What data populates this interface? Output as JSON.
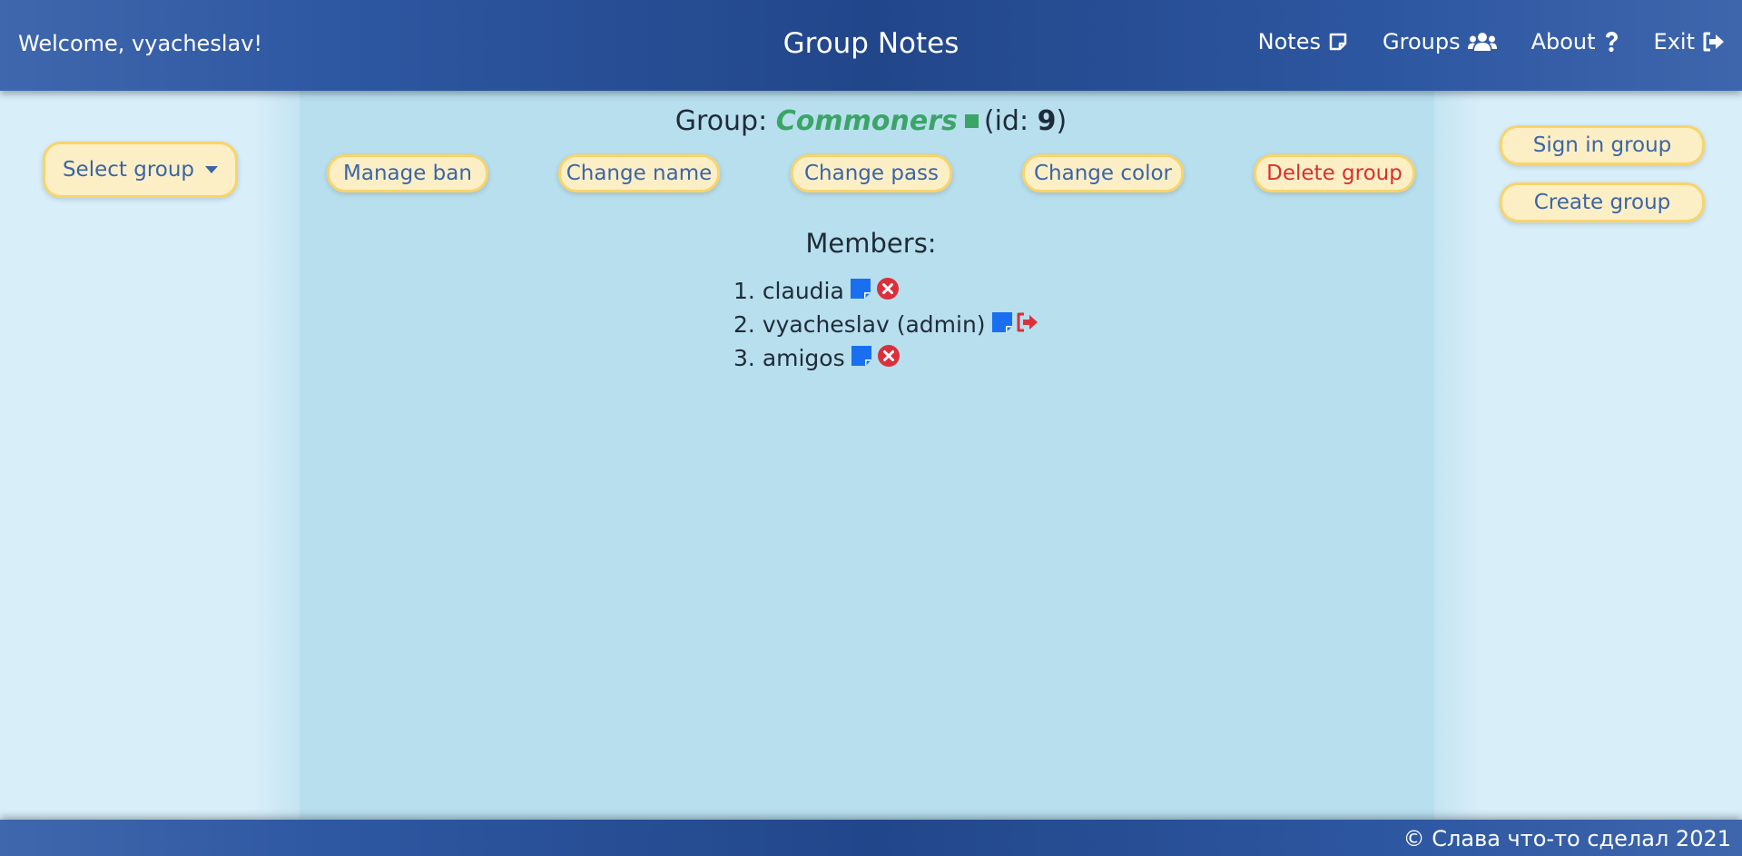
{
  "header": {
    "welcome": "Welcome, vyacheslav!",
    "title": "Group Notes",
    "nav": [
      {
        "label": "Notes",
        "icon": "note-icon"
      },
      {
        "label": "Groups",
        "icon": "users-icon"
      },
      {
        "label": "About",
        "icon": "question-icon"
      },
      {
        "label": "Exit",
        "icon": "sign-out-icon"
      }
    ]
  },
  "sidebar_left": {
    "select_group_label": "Select group"
  },
  "sidebar_right": {
    "sign_in_label": "Sign in group",
    "create_label": "Create group"
  },
  "group": {
    "prefix": "Group:",
    "name": "Commoners",
    "id_prefix": "(id: ",
    "id": "9",
    "id_suffix": ")",
    "color": "#3aa567"
  },
  "actions": {
    "manage_ban": "Manage ban",
    "change_name": "Change name",
    "change_pass": "Change pass",
    "change_color": "Change color",
    "delete_group": "Delete group"
  },
  "members": {
    "title": "Members:",
    "items": [
      {
        "num": "1.",
        "name": "claudia",
        "action_icon": "remove-member-icon"
      },
      {
        "num": "2.",
        "name": "vyacheslav (admin)",
        "action_icon": "leave-group-icon"
      },
      {
        "num": "3.",
        "name": "amigos",
        "action_icon": "remove-member-icon"
      }
    ]
  },
  "colors": {
    "accent_blue": "#1a6ff0",
    "danger_red": "#d9303c",
    "button_bg": "#fdefc5",
    "button_border": "#f8d46b",
    "navbar": "#2d57a1"
  },
  "footer": {
    "text": "© Слава что-то сделал 2021"
  }
}
